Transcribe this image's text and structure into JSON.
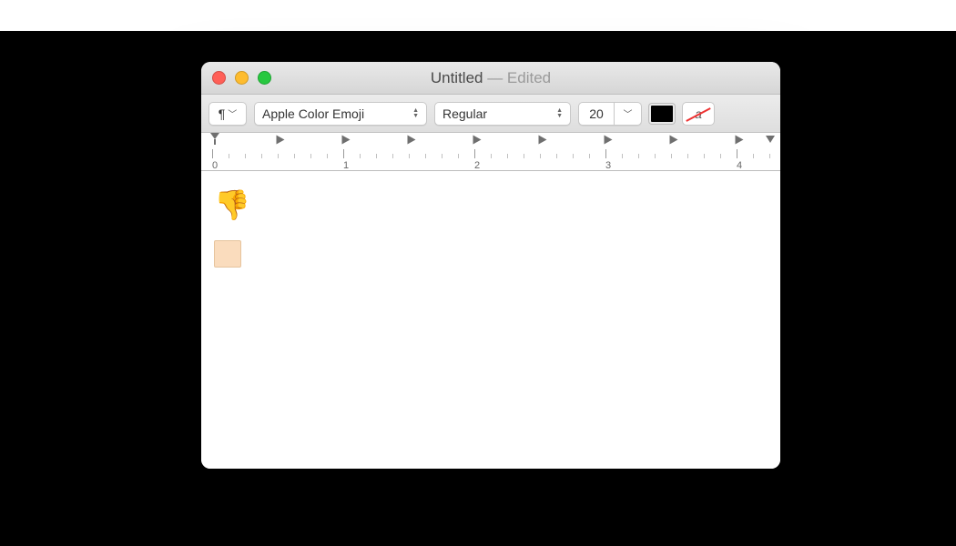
{
  "window": {
    "title_main": "Untitled",
    "title_suffix": " — Edited"
  },
  "toolbar": {
    "paragraph_glyph": "¶",
    "font_family": "Apple Color Emoji",
    "font_style": "Regular",
    "font_size": "20",
    "text_color": "#000000",
    "highlight_letter": "a"
  },
  "ruler": {
    "labels": [
      "0",
      "1",
      "2",
      "3",
      "4"
    ]
  },
  "document": {
    "line1_emoji": "👎",
    "line2_skin_tone_swatch": "#fadcbd"
  }
}
